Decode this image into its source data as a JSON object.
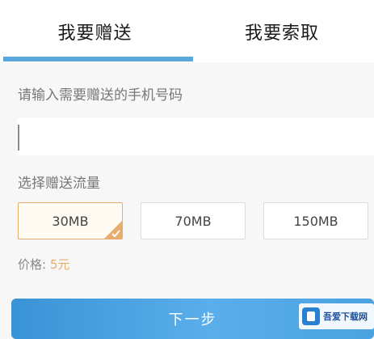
{
  "tabs": {
    "give_label": "我要赠送",
    "ask_label": "我要索取",
    "active": "give"
  },
  "form": {
    "phone_label": "请输入需要赠送的手机号码",
    "phone_value": "",
    "flow_label": "选择赠送流量",
    "options": [
      {
        "label": "30MB",
        "selected": true
      },
      {
        "label": "70MB",
        "selected": false
      },
      {
        "label": "150MB",
        "selected": false
      }
    ],
    "price_label": "价格:",
    "price_value": "5元"
  },
  "next_button": {
    "label": "下一步"
  },
  "watermark": {
    "title": "吾爱下载网"
  },
  "colors": {
    "accent": "#5aa7dc",
    "selected_border": "#e6ad6f",
    "button": "#4aa2e0"
  }
}
